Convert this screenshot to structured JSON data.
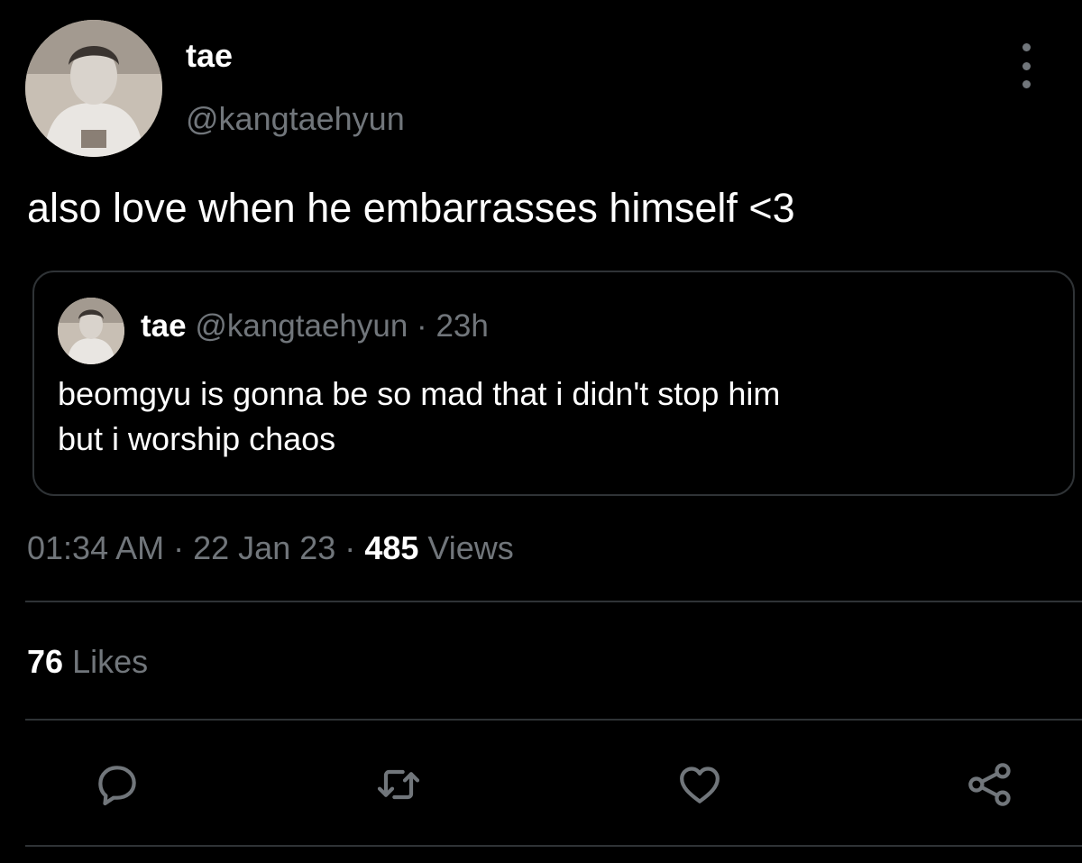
{
  "tweet": {
    "author": {
      "name": "tae",
      "handle": "@kangtaehyun"
    },
    "text": "also love when he embarrasses himself <3",
    "quoted": {
      "name": "tae",
      "handle": "@kangtaehyun",
      "separator": "·",
      "time": "23h",
      "text": "beomgyu is gonna be so mad that i didn't stop him\nbut i worship chaos"
    },
    "meta": {
      "time": "01:34 AM",
      "separator": "·",
      "date": "22 Jan 23",
      "views_count": "485",
      "views_label": "Views"
    },
    "likes": {
      "count": "76",
      "label": "Likes"
    }
  },
  "icons": {
    "more": "more-vertical-icon",
    "reply": "reply-icon",
    "retweet": "retweet-icon",
    "like": "heart-icon",
    "share": "share-icon"
  },
  "colors": {
    "background": "#000000",
    "primary_text": "#ffffff",
    "secondary_text": "#71767b",
    "border": "#2f3336"
  }
}
